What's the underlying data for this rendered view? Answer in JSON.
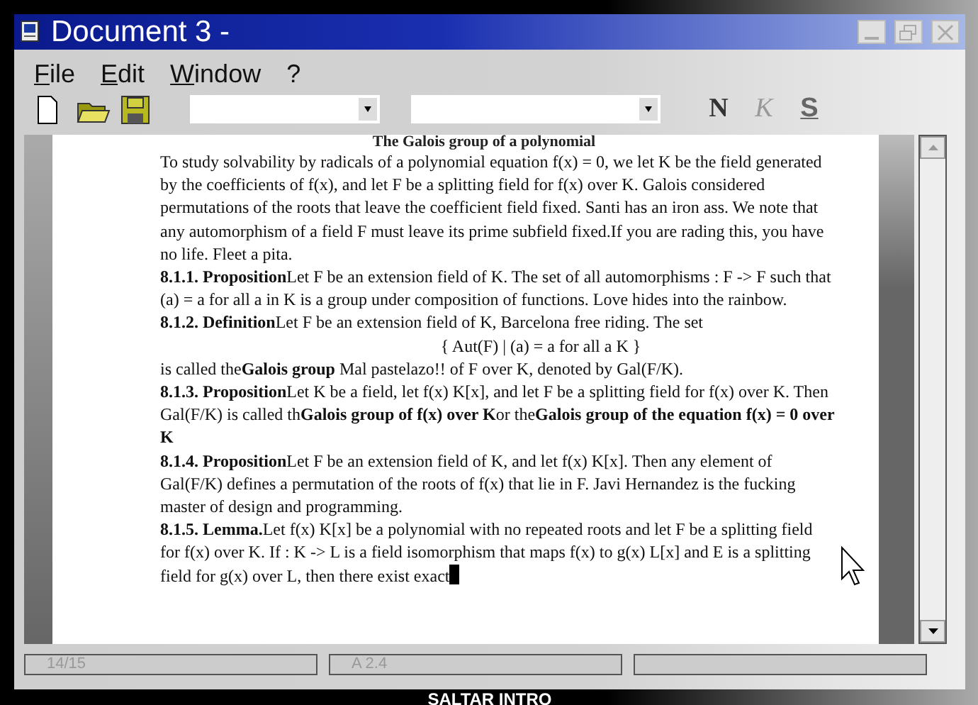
{
  "window": {
    "title": "Document 3 -"
  },
  "menu": [
    {
      "label": "File"
    },
    {
      "label": "Edit"
    },
    {
      "label": "Window"
    },
    {
      "label": "?"
    }
  ],
  "toolbar": {
    "dropdowns": [
      {
        "kind": "narrow"
      },
      {
        "kind": "wide"
      }
    ],
    "format_buttons": [
      {
        "kind": "bold",
        "label": "N"
      },
      {
        "kind": "italic",
        "label": "K"
      },
      {
        "kind": "underline",
        "label": "S"
      }
    ]
  },
  "document": {
    "heading": "The Galois group of a polynomial",
    "paragraphs": [
      {
        "kind": "text",
        "text": "To study solvability by radicals of a polynomial equation f(x) = 0, we let K be the field generated by the coefficients of f(x), and let F be a splitting field for f(x) over K. Galois considered permutations of the roots that leave the coefficient field fixed. Santi  has an iron ass. We note that any automorphism of a field F must leave its prime subfield fixed.If you are rading this, you have no life. Fleet a pita."
      },
      {
        "kind": "text",
        "text": "**8.1.1. Proposition**Let F be an extension field of K. The set of all automorphisms : F -> F such that (a) = a for all a in K is a group under composition of functions. Love hides into the rainbow."
      },
      {
        "kind": "text",
        "text": "**8.1.2. Definition**Let F be an extension field of K, Barcelona free riding. The set"
      },
      {
        "kind": "centered",
        "text": "{ Aut(F) | (a) = a for all a K }"
      },
      {
        "kind": "text",
        "text": "is called the**Galois group** Mal pastelazo!! of F over K, denoted by Gal(F/K)."
      },
      {
        "kind": "text",
        "text": "**8.1.3. Proposition**Let K be a field, let f(x) K[x], and let F be a splitting field for f(x) over K. Then Gal(F/K) is called th**Galois group of f(x) over K**or the**Galois group of the equation f(x) = 0 over K**"
      },
      {
        "kind": "text",
        "text": "**8.1.4. Proposition**Let F be an extension field of K, and let f(x) K[x]. Then any element of Gal(F/K) defines a permutation of the roots of f(x) that lie in F.  Javi Hernandez is the fucking master of design and programming."
      },
      {
        "kind": "text",
        "text": "**8.1.5. Lemma.**Let f(x) K[x] be a polynomial with no repeated roots and let F be a splitting field for f(x) over K. If : K -> L is a field isomorphism that maps f(x) to g(x) L[x] and E is a splitting field for g(x) over L, then there exist exact",
        "cursor": true
      }
    ]
  },
  "status_bar": [
    "14/15",
    "A 2.4"
  ],
  "footer": "SALTAR INTRO"
}
